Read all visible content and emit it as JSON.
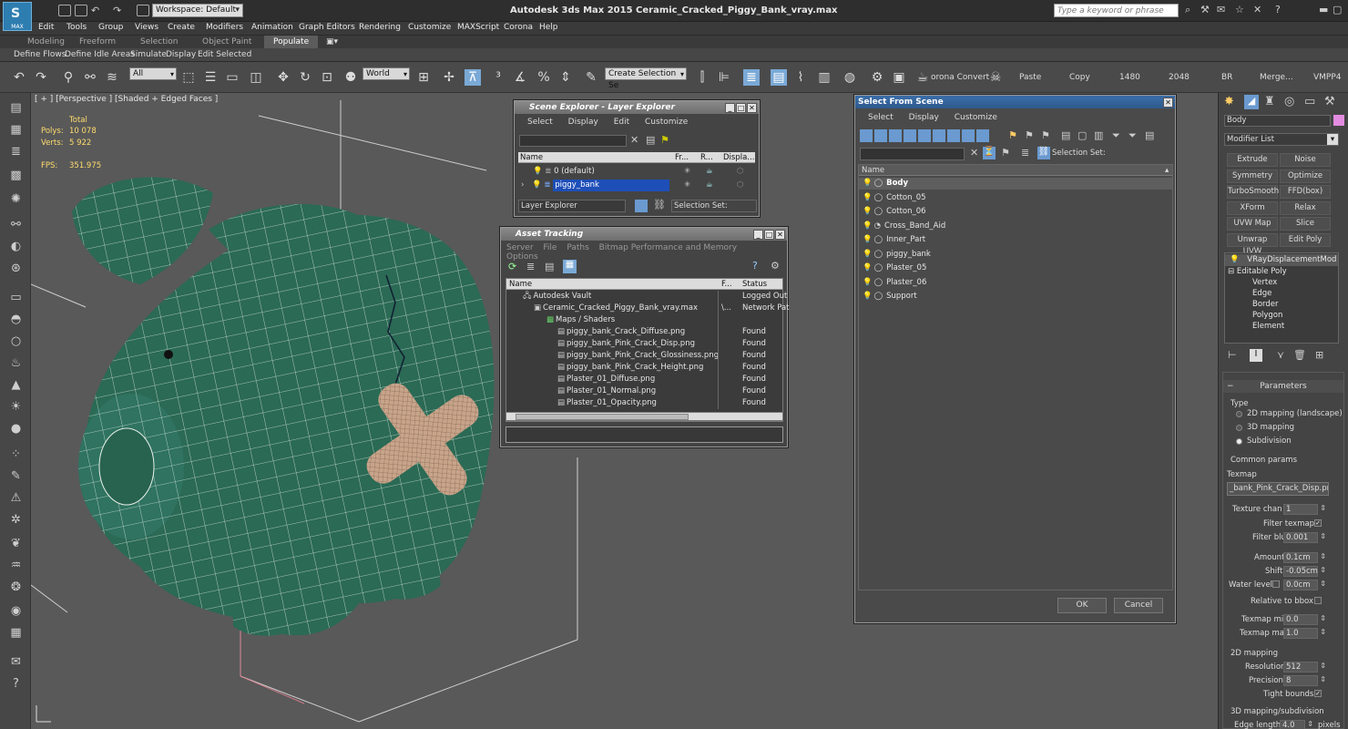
{
  "title_bar": {
    "logo_text": "MAX",
    "workspace": "Workspace: Default",
    "app_title": "Autodesk 3ds Max  2015      Ceramic_Cracked_Piggy_Bank_vray.max",
    "search_placeholder": "Type a keyword or phrase"
  },
  "menu": [
    "Edit",
    "Tools",
    "Group",
    "Views",
    "Create",
    "Modifiers",
    "Animation",
    "Graph Editors",
    "Rendering",
    "Customize",
    "MAXScript",
    "Corona",
    "Help"
  ],
  "ribbon_tabs": [
    "Modeling",
    "Freeform",
    "Selection",
    "Object Paint",
    "Populate"
  ],
  "ribbon_sub": [
    "Define Flows",
    "Define Idle Areas",
    "Simulate",
    "Display",
    "Edit Selected"
  ],
  "toolbar": {
    "filter": "All",
    "coord": "World",
    "named_sel": "Create Selection Se",
    "render_items": [
      "orona Convert",
      "Paste",
      "Copy",
      "1480",
      "2048",
      "BR",
      "Merge...",
      "VMPP4"
    ]
  },
  "viewport": {
    "label": "[ + ] [Perspective ] [Shaded + Edged Faces ]",
    "stats": {
      "total": "Total",
      "polys_label": "Polys:",
      "polys": "10 078",
      "verts_label": "Verts:",
      "verts": "5 922",
      "fps_label": "FPS:",
      "fps": "351.975"
    }
  },
  "layer_explorer": {
    "title": "Scene Explorer - Layer Explorer",
    "menu": [
      "Select",
      "Display",
      "Edit",
      "Customize"
    ],
    "columns": [
      "Name",
      "Fr...",
      "R...",
      "Displa..."
    ],
    "rows": [
      "0 (default)",
      "piggy_bank"
    ],
    "footer_left": "Layer Explorer",
    "footer_right": "Selection Set:"
  },
  "asset_tracking": {
    "title": "Asset Tracking",
    "menu": [
      "Server",
      "File",
      "Paths",
      "Bitmap Performance and Memory",
      "Options"
    ],
    "columns": [
      "Name",
      "F...",
      "Status"
    ],
    "rows": [
      {
        "name": "Autodesk Vault",
        "status": "Logged Out"
      },
      {
        "name": "Ceramic_Cracked_Piggy_Bank_vray.max",
        "f": "\\...",
        "status": "Network Pat"
      },
      {
        "name": "Maps / Shaders",
        "status": ""
      },
      {
        "name": "piggy_bank_Crack_Diffuse.png",
        "status": "Found"
      },
      {
        "name": "piggy_bank_Pink_Crack_Disp.png",
        "status": "Found"
      },
      {
        "name": "piggy_bank_Pink_Crack_Glossiness.png",
        "status": "Found"
      },
      {
        "name": "piggy_bank_Pink_Crack_Height.png",
        "status": "Found"
      },
      {
        "name": "Plaster_01_Diffuse.png",
        "status": "Found"
      },
      {
        "name": "Plaster_01_Normal.png",
        "status": "Found"
      },
      {
        "name": "Plaster_01_Opacity.png",
        "status": "Found"
      }
    ]
  },
  "select_from_scene": {
    "title": "Select From Scene",
    "menu": [
      "Select",
      "Display",
      "Customize"
    ],
    "selection_set": "Selection Set:",
    "column": "Name",
    "rows": [
      "Body",
      "Cotton_05",
      "Cotton_06",
      "Cross_Band_Aid",
      "Inner_Part",
      "piggy_bank",
      "Plaster_05",
      "Plaster_06",
      "Support"
    ],
    "ok": "OK",
    "cancel": "Cancel"
  },
  "command_panel": {
    "object_name": "Body",
    "modifier_list": "Modifier List",
    "buttons": [
      "Extrude",
      "Noise",
      "Symmetry",
      "Optimize",
      "TurboSmooth",
      "FFD(box)",
      "XForm",
      "Relax",
      "UVW Map",
      "Slice",
      "Unwrap UVW",
      "Edit Poly"
    ],
    "stack": [
      "VRayDisplacementMod",
      "Editable Poly",
      "Vertex",
      "Edge",
      "Border",
      "Polygon",
      "Element"
    ],
    "rollout": "Parameters",
    "type_label": "Type",
    "type_options": [
      "2D mapping (landscape)",
      "3D mapping",
      "Subdivision"
    ],
    "common_params": "Common params",
    "texmap_label": "Texmap",
    "texmap_value": "_bank_Pink_Crack_Disp.png)",
    "texture_chan_label": "Texture chan",
    "texture_chan": "1",
    "filter_texmap": "Filter texmap",
    "filter_blur_label": "Filter blur",
    "filter_blur": "0.001",
    "amount_label": "Amount",
    "amount": "0.1cm",
    "shift_label": "Shift",
    "shift": "-0.05cm",
    "water_level_label": "Water level",
    "water_level": "0.0cm",
    "relative_bbox": "Relative to bbox",
    "texmap_min_label": "Texmap min",
    "texmap_min": "0.0",
    "texmap_max_label": "Texmap max",
    "texmap_max": "1.0",
    "mapping_2d": "2D mapping",
    "resolution_label": "Resolution",
    "resolution": "512",
    "precision_label": "Precision",
    "precision": "8",
    "tight_bounds": "Tight bounds",
    "mapping_3d": "3D mapping/subdivision",
    "edge_length_label": "Edge length",
    "edge_length": "4.0",
    "edge_length_unit": "pixels"
  },
  "colors": {
    "piggy_green": "#2b6a55",
    "wire": "#e8f0e8",
    "selection_blue": "#1e4fb8",
    "bandage": "#c7a48a"
  }
}
